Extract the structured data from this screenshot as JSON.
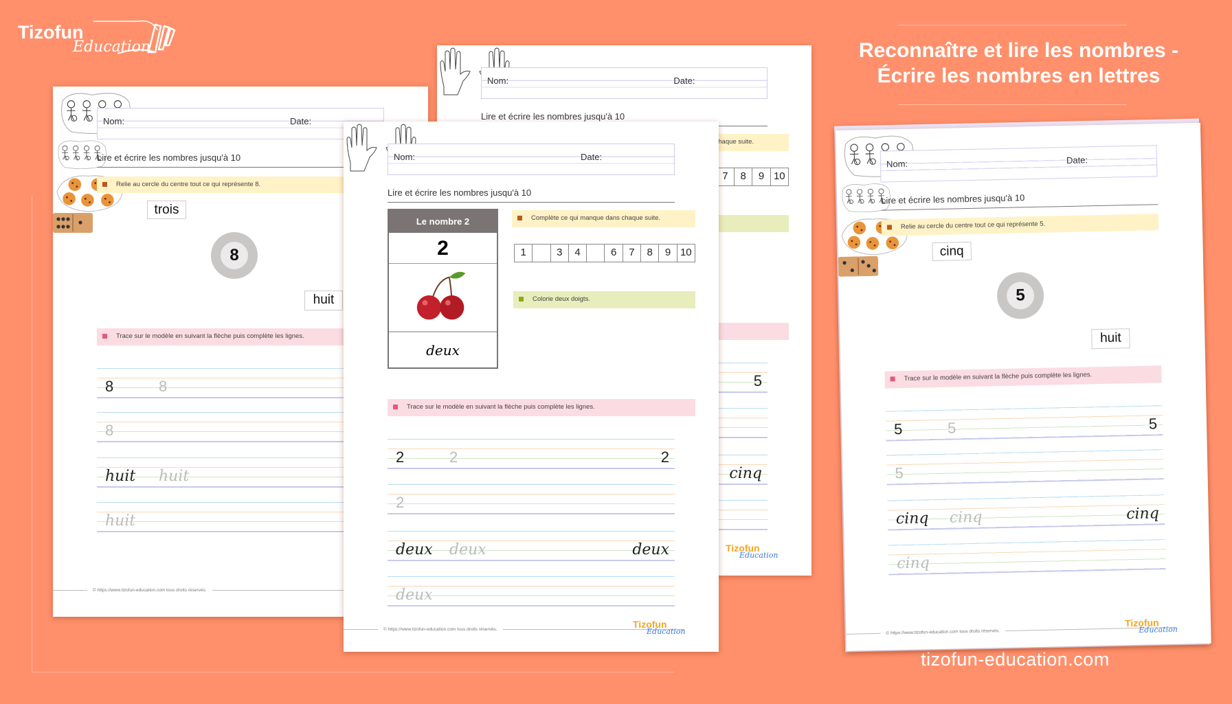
{
  "brand": {
    "logo_word1": "Tizofun",
    "logo_word2": "Education"
  },
  "headline": {
    "line1": "Reconnaître et lire les nombres -",
    "line2": "Écrire les nombres en lettres"
  },
  "website": "tizofun-education.com",
  "colors": {
    "background": "#FF906B",
    "yellow_bar": "#FFF2C6",
    "green_bar": "#E8EDBC",
    "pink_bar": "#FBDCE3",
    "number_card_header": "#7A7474"
  },
  "worksheets": [
    {
      "type": "relie",
      "name_label": "Nom:",
      "date_label": "Date:",
      "heading": "Lire et écrire les nombres jusqu'à 10",
      "instruction1": "Relie au cercle du centre tout ce qui représente 8.",
      "word_top": "trois",
      "number": "8",
      "word_bottom": "huit",
      "instruction2": "Trace sur le modèle en suivant la flèche puis complète les lignes.",
      "trace_digit": "8",
      "trace_word": "huit",
      "trace_end": "",
      "footer": "© https://www.tizofun-education.com tous droits réservés."
    },
    {
      "type": "nombre",
      "name_label": "Nom:",
      "date_label": "Date:",
      "heading": "Lire et écrire les nombres jusqu'à 10",
      "card_title": "",
      "number": "",
      "word": "",
      "instruction1": "Complète ce qui manque dans chaque suite.",
      "sequence": [
        "",
        "",
        "",
        "",
        "",
        "",
        "7",
        "8",
        "9",
        "10"
      ],
      "instruction2": "",
      "instruction3": "",
      "trace_digit": "",
      "trace_word": "",
      "trace_end_digit": "5",
      "trace_end_word": "cinq",
      "footer": "",
      "logo1": "Tizofun",
      "logo2": "Education"
    },
    {
      "type": "nombre",
      "name_label": "Nom:",
      "date_label": "Date:",
      "heading": "Lire et écrire les nombres jusqu'à 10",
      "card_title": "Le nombre 2",
      "number": "2",
      "word": "deux",
      "instruction1": "Complète ce qui manque dans chaque suite.",
      "sequence": [
        "1",
        "",
        "3",
        "4",
        "",
        "6",
        "7",
        "8",
        "9",
        "10"
      ],
      "instruction2": "Colorie deux doigts.",
      "instruction3": "Trace sur le modèle en suivant la flèche puis complète les lignes.",
      "trace_digit": "2",
      "trace_word": "deux",
      "trace_end_digit": "2",
      "trace_end_word": "deux",
      "footer": "© https://www.tizofun-education.com tous droits réservés.",
      "logo1": "Tizofun",
      "logo2": "Education"
    },
    {
      "type": "relie",
      "name_label": "Nom:",
      "date_label": "Date:",
      "heading": "Lire et écrire les nombres jusqu'à 10",
      "instruction1": "Relie au cercle du centre tout ce qui représente 5.",
      "word_top": "cinq",
      "number": "5",
      "word_bottom": "huit",
      "instruction2": "Trace sur le modèle en suivant la flèche puis complète les lignes.",
      "trace_digit": "5",
      "trace_word": "cinq",
      "trace_end": "yes",
      "footer": "© https://www.tizofun-education.com tous droits réservés.",
      "logo1": "Tizofun",
      "logo2": "Education"
    }
  ]
}
